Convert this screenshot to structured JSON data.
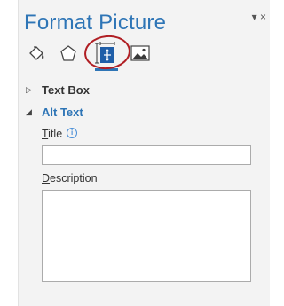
{
  "pane": {
    "title": "Format Picture",
    "menu_arrow": "▾",
    "close_glyph": "×",
    "accent_color": "#2e75b6",
    "highlight_color": "#b01e23"
  },
  "tabs": [
    {
      "name": "fill-line",
      "icon": "paint-bucket-icon"
    },
    {
      "name": "effects",
      "icon": "pentagon-icon"
    },
    {
      "name": "size-properties",
      "icon": "size-properties-icon",
      "selected": true
    },
    {
      "name": "picture",
      "icon": "picture-icon"
    }
  ],
  "sections": {
    "text_box": {
      "label": "Text Box",
      "expanded": false,
      "arrow": "▷"
    },
    "alt_text": {
      "label": "Alt Text",
      "expanded": true,
      "arrow": "◢"
    }
  },
  "alt_text": {
    "title_label_first": "T",
    "title_label_rest": "itle",
    "info_glyph": "i",
    "title_value": "",
    "description_label_first": "D",
    "description_label_rest": "escription",
    "description_value": ""
  }
}
